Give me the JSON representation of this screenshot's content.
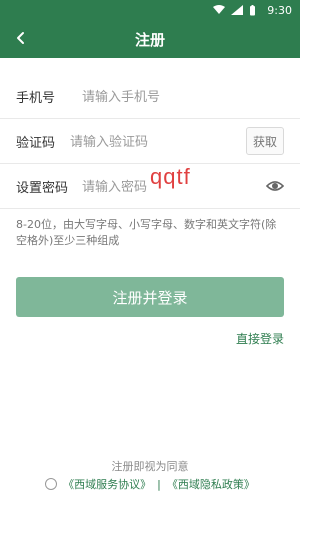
{
  "status_bar": {
    "time": "9:30"
  },
  "header": {
    "title": "注册"
  },
  "form": {
    "phone_label": "手机号",
    "phone_placeholder": "请输入手机号",
    "code_label": "验证码",
    "code_placeholder": "请输入验证码",
    "get_code_label": "获取",
    "password_label": "设置密码",
    "password_placeholder": "请输入密码",
    "password_hint": "8-20位，由大写字母、小写字母、数字和英文字符(除空格外)至少三种组成"
  },
  "actions": {
    "register_login_label": "注册并登录",
    "direct_login_label": "直接登录"
  },
  "agreements": {
    "prefix": "注册即视为同意",
    "service_link": "《西域服务协议》",
    "separator": "|",
    "privacy_link": "《西域隐私政策》"
  },
  "overlay": {
    "watermark_text": "qqtf"
  },
  "colors": {
    "brand": "#2e7d4f",
    "button": "#7fb799"
  }
}
